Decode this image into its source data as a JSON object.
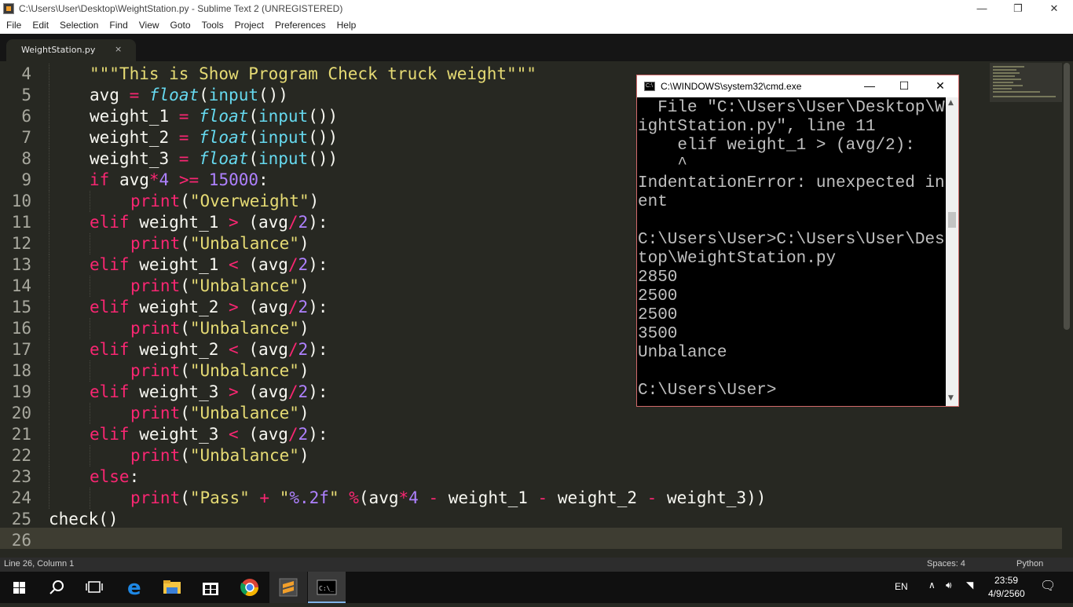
{
  "window": {
    "title": "C:\\Users\\User\\Desktop\\WeightStation.py - Sublime Text 2 (UNREGISTERED)",
    "minimize_glyph": "—",
    "maximize_glyph": "❐",
    "close_glyph": "✕"
  },
  "menu": [
    "File",
    "Edit",
    "Selection",
    "Find",
    "View",
    "Goto",
    "Tools",
    "Project",
    "Preferences",
    "Help"
  ],
  "tab": {
    "label": "WeightStation.py",
    "close_glyph": "×"
  },
  "editor": {
    "lines": [
      {
        "n": "4",
        "indent": 1,
        "tokens": [
          [
            "st",
            "\"\"\"This is Show Program Check truck weight\"\"\""
          ]
        ]
      },
      {
        "n": "5",
        "indent": 1,
        "tokens": [
          [
            "tx",
            "avg "
          ],
          [
            "op",
            "="
          ],
          [
            "tx",
            " "
          ],
          [
            "bi",
            "float"
          ],
          [
            "tx",
            "("
          ],
          [
            "fn",
            "input"
          ],
          [
            "tx",
            "())"
          ]
        ]
      },
      {
        "n": "6",
        "indent": 1,
        "tokens": [
          [
            "tx",
            "weight_1 "
          ],
          [
            "op",
            "="
          ],
          [
            "tx",
            " "
          ],
          [
            "bi",
            "float"
          ],
          [
            "tx",
            "("
          ],
          [
            "fn",
            "input"
          ],
          [
            "tx",
            "())"
          ]
        ]
      },
      {
        "n": "7",
        "indent": 1,
        "tokens": [
          [
            "tx",
            "weight_2 "
          ],
          [
            "op",
            "="
          ],
          [
            "tx",
            " "
          ],
          [
            "bi",
            "float"
          ],
          [
            "tx",
            "("
          ],
          [
            "fn",
            "input"
          ],
          [
            "tx",
            "())"
          ]
        ]
      },
      {
        "n": "8",
        "indent": 1,
        "tokens": [
          [
            "tx",
            "weight_3 "
          ],
          [
            "op",
            "="
          ],
          [
            "tx",
            " "
          ],
          [
            "bi",
            "float"
          ],
          [
            "tx",
            "("
          ],
          [
            "fn",
            "input"
          ],
          [
            "tx",
            "())"
          ]
        ]
      },
      {
        "n": "9",
        "indent": 1,
        "tokens": [
          [
            "kw",
            "if"
          ],
          [
            "tx",
            " avg"
          ],
          [
            "op",
            "*"
          ],
          [
            "nu",
            "4"
          ],
          [
            "tx",
            " "
          ],
          [
            "op",
            ">="
          ],
          [
            "tx",
            " "
          ],
          [
            "nu",
            "15000"
          ],
          [
            "tx",
            ":"
          ]
        ]
      },
      {
        "n": "10",
        "indent": 2,
        "tokens": [
          [
            "kw",
            "print"
          ],
          [
            "tx",
            "("
          ],
          [
            "st",
            "\"Overweight\""
          ],
          [
            "tx",
            ")"
          ]
        ]
      },
      {
        "n": "11",
        "indent": 1,
        "tokens": [
          [
            "kw",
            "elif"
          ],
          [
            "tx",
            " weight_1 "
          ],
          [
            "op",
            ">"
          ],
          [
            "tx",
            " (avg"
          ],
          [
            "op",
            "/"
          ],
          [
            "nu",
            "2"
          ],
          [
            "tx",
            "):"
          ]
        ]
      },
      {
        "n": "12",
        "indent": 2,
        "tokens": [
          [
            "kw",
            "print"
          ],
          [
            "tx",
            "("
          ],
          [
            "st",
            "\"Unbalance\""
          ],
          [
            "tx",
            ")"
          ]
        ]
      },
      {
        "n": "13",
        "indent": 1,
        "tokens": [
          [
            "kw",
            "elif"
          ],
          [
            "tx",
            " weight_1 "
          ],
          [
            "op",
            "<"
          ],
          [
            "tx",
            " (avg"
          ],
          [
            "op",
            "/"
          ],
          [
            "nu",
            "2"
          ],
          [
            "tx",
            "):"
          ]
        ]
      },
      {
        "n": "14",
        "indent": 2,
        "tokens": [
          [
            "kw",
            "print"
          ],
          [
            "tx",
            "("
          ],
          [
            "st",
            "\"Unbalance\""
          ],
          [
            "tx",
            ")"
          ]
        ]
      },
      {
        "n": "15",
        "indent": 1,
        "tokens": [
          [
            "kw",
            "elif"
          ],
          [
            "tx",
            " weight_2 "
          ],
          [
            "op",
            ">"
          ],
          [
            "tx",
            " (avg"
          ],
          [
            "op",
            "/"
          ],
          [
            "nu",
            "2"
          ],
          [
            "tx",
            "):"
          ]
        ]
      },
      {
        "n": "16",
        "indent": 2,
        "tokens": [
          [
            "kw",
            "print"
          ],
          [
            "tx",
            "("
          ],
          [
            "st",
            "\"Unbalance\""
          ],
          [
            "tx",
            ")"
          ]
        ]
      },
      {
        "n": "17",
        "indent": 1,
        "tokens": [
          [
            "kw",
            "elif"
          ],
          [
            "tx",
            " weight_2 "
          ],
          [
            "op",
            "<"
          ],
          [
            "tx",
            " (avg"
          ],
          [
            "op",
            "/"
          ],
          [
            "nu",
            "2"
          ],
          [
            "tx",
            "):"
          ]
        ]
      },
      {
        "n": "18",
        "indent": 2,
        "tokens": [
          [
            "kw",
            "print"
          ],
          [
            "tx",
            "("
          ],
          [
            "st",
            "\"Unbalance\""
          ],
          [
            "tx",
            ")"
          ]
        ]
      },
      {
        "n": "19",
        "indent": 1,
        "tokens": [
          [
            "kw",
            "elif"
          ],
          [
            "tx",
            " weight_3 "
          ],
          [
            "op",
            ">"
          ],
          [
            "tx",
            " (avg"
          ],
          [
            "op",
            "/"
          ],
          [
            "nu",
            "2"
          ],
          [
            "tx",
            "):"
          ]
        ]
      },
      {
        "n": "20",
        "indent": 2,
        "tokens": [
          [
            "kw",
            "print"
          ],
          [
            "tx",
            "("
          ],
          [
            "st",
            "\"Unbalance\""
          ],
          [
            "tx",
            ")"
          ]
        ]
      },
      {
        "n": "21",
        "indent": 1,
        "tokens": [
          [
            "kw",
            "elif"
          ],
          [
            "tx",
            " weight_3 "
          ],
          [
            "op",
            "<"
          ],
          [
            "tx",
            " (avg"
          ],
          [
            "op",
            "/"
          ],
          [
            "nu",
            "2"
          ],
          [
            "tx",
            "):"
          ]
        ]
      },
      {
        "n": "22",
        "indent": 2,
        "tokens": [
          [
            "kw",
            "print"
          ],
          [
            "tx",
            "("
          ],
          [
            "st",
            "\"Unbalance\""
          ],
          [
            "tx",
            ")"
          ]
        ]
      },
      {
        "n": "23",
        "indent": 1,
        "tokens": [
          [
            "kw",
            "else"
          ],
          [
            "tx",
            ":"
          ]
        ]
      },
      {
        "n": "24",
        "indent": 2,
        "tokens": [
          [
            "kw",
            "print"
          ],
          [
            "tx",
            "("
          ],
          [
            "st",
            "\"Pass\""
          ],
          [
            "tx",
            " "
          ],
          [
            "op",
            "+"
          ],
          [
            "tx",
            " "
          ],
          [
            "st",
            "\""
          ],
          [
            "nu",
            "%.2f"
          ],
          [
            "st",
            "\""
          ],
          [
            "tx",
            " "
          ],
          [
            "op",
            "%"
          ],
          [
            "tx",
            "(avg"
          ],
          [
            "op",
            "*"
          ],
          [
            "nu",
            "4"
          ],
          [
            "tx",
            " "
          ],
          [
            "op",
            "-"
          ],
          [
            "tx",
            " weight_1 "
          ],
          [
            "op",
            "-"
          ],
          [
            "tx",
            " weight_2 "
          ],
          [
            "op",
            "-"
          ],
          [
            "tx",
            " weight_3))"
          ]
        ]
      },
      {
        "n": "25",
        "indent": 0,
        "tokens": [
          [
            "tx",
            "check()"
          ]
        ]
      },
      {
        "n": "26",
        "indent": 0,
        "tokens": []
      }
    ]
  },
  "statusbar": {
    "position": "Line 26, Column 1",
    "spaces": "Spaces: 4",
    "syntax": "Python"
  },
  "cmd": {
    "title": "C:\\WINDOWS\\system32\\cmd.exe",
    "icon_text": "C:\\",
    "lines": [
      "  File \"C:\\Users\\User\\Desktop\\We",
      "ightStation.py\", line 11",
      "    elif weight_1 > (avg/2):",
      "    ^",
      "IndentationError: unexpected ind",
      "ent",
      "",
      "C:\\Users\\User>C:\\Users\\User\\Desk",
      "top\\WeightStation.py",
      "2850",
      "2500",
      "2500",
      "3500",
      "Unbalance",
      "",
      "C:\\Users\\User>"
    ]
  },
  "taskbar": {
    "icons": [
      "windows-start-icon",
      "search-icon",
      "task-view-icon",
      "edge-icon",
      "file-explorer-icon",
      "store-icon",
      "chrome-icon",
      "sublime-icon",
      "cmd-icon"
    ],
    "language": "EN",
    "time": "23:59",
    "date": "4/9/2560"
  },
  "colors": {
    "accent": "#f92672",
    "string": "#e6db74",
    "number": "#ae81ff",
    "builtin": "#66d9ef",
    "background": "#272822"
  }
}
